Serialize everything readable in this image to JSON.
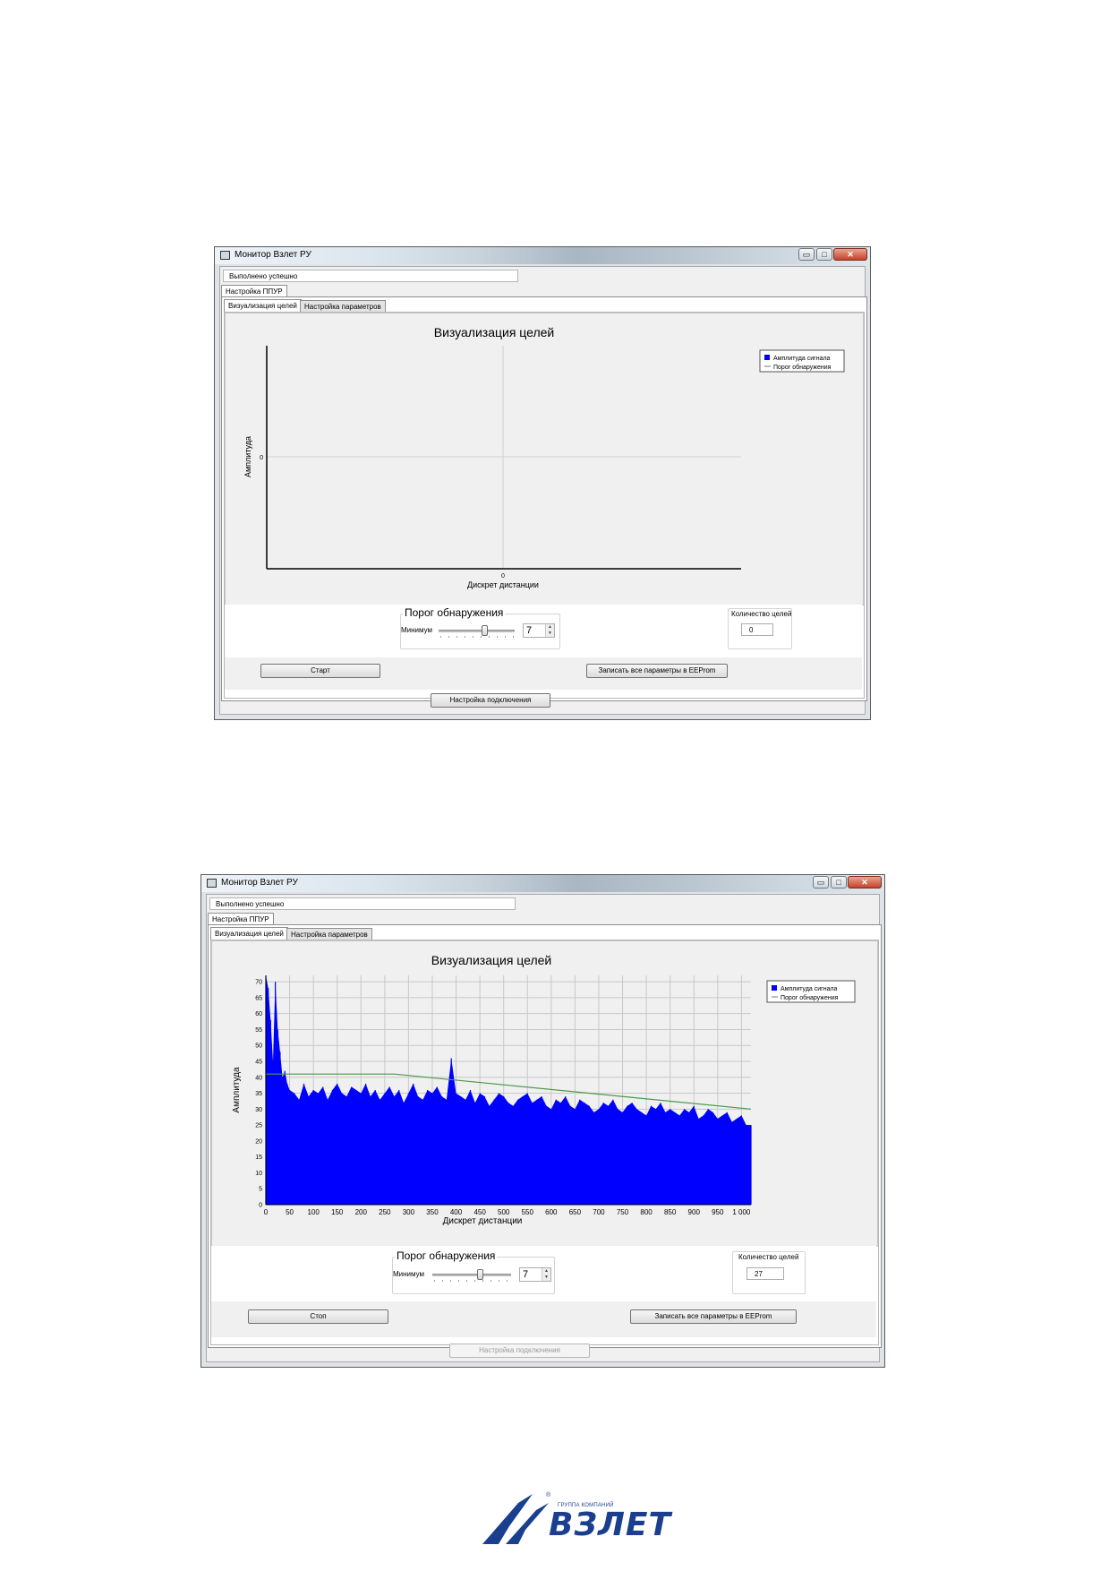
{
  "screenshots": [
    {
      "window_title": "Монитор Взлет РУ",
      "status": "Выполнено успешно",
      "outer_tab": "Настройка ППУР",
      "tabs": [
        "Визуализация целей",
        "Настройка параметров"
      ],
      "threshold_group": "Порог обнаружения",
      "min_label": "Минимум",
      "min_value": "7",
      "count_label": "Количество целей",
      "count_value": "0",
      "start_button": "Старт",
      "save_button": "Записать все параметры в EEProm",
      "connect_button": "Настройка подключения"
    },
    {
      "window_title": "Монитор Взлет РУ",
      "status": "Выполнено успешно",
      "outer_tab": "Настройка ППУР",
      "tabs": [
        "Визуализация целей",
        "Настройка параметров"
      ],
      "threshold_group": "Порог обнаружения",
      "min_label": "Минимум",
      "min_value": "7",
      "count_label": "Количество целей",
      "count_value": "27",
      "stop_button": "Стоп",
      "save_button": "Записать все параметры в EEProm",
      "connect_button": "Настройка подключения"
    }
  ],
  "window_controls": {
    "minimize": "▭",
    "maximize": "□",
    "close": "✕"
  },
  "chart_data": [
    {
      "type": "line",
      "title": "Визуализация целей",
      "xlabel": "Дискрет дистанции",
      "ylabel": "Амплитуда",
      "x_ticks": [
        "0"
      ],
      "y_ticks": [
        "0"
      ],
      "legend": [
        "Амплитуда сигнала",
        "Порог обнаружения"
      ],
      "legend_position": "top-right",
      "series": [
        {
          "name": "Амплитуда сигнала",
          "values": [],
          "color": "#0000ff"
        },
        {
          "name": "Порог обнаружения",
          "values": [],
          "color": "#4a9a4a"
        }
      ],
      "grid": true
    },
    {
      "type": "bar",
      "title": "Визуализация целей",
      "xlabel": "Дискрет дистанции",
      "ylabel": "Амплитуда",
      "xlim": [
        0,
        1020
      ],
      "ylim": [
        0,
        72
      ],
      "x_ticks": [
        "0",
        "50",
        "100",
        "150",
        "200",
        "250",
        "300",
        "350",
        "400",
        "450",
        "500",
        "550",
        "600",
        "650",
        "700",
        "750",
        "800",
        "850",
        "900",
        "950",
        "1 000"
      ],
      "y_ticks": [
        "0",
        "5",
        "10",
        "15",
        "20",
        "25",
        "30",
        "35",
        "40",
        "45",
        "50",
        "55",
        "60",
        "65",
        "70"
      ],
      "legend": [
        "Амплитуда сигнала",
        "Порог обнаружения"
      ],
      "legend_position": "top-right",
      "grid": true,
      "series": [
        {
          "name": "Амплитуда сигнала",
          "type": "bar",
          "color": "#0000ff",
          "x": [
            0,
            5,
            10,
            15,
            20,
            25,
            30,
            35,
            40,
            45,
            50,
            60,
            70,
            80,
            90,
            100,
            110,
            120,
            130,
            140,
            150,
            160,
            170,
            180,
            190,
            200,
            210,
            220,
            230,
            240,
            250,
            260,
            270,
            280,
            290,
            300,
            310,
            320,
            330,
            340,
            350,
            360,
            370,
            380,
            390,
            400,
            410,
            420,
            430,
            440,
            450,
            460,
            470,
            480,
            490,
            500,
            510,
            520,
            530,
            540,
            550,
            560,
            570,
            580,
            590,
            600,
            610,
            620,
            630,
            640,
            650,
            660,
            670,
            680,
            690,
            700,
            710,
            720,
            730,
            740,
            750,
            760,
            770,
            780,
            790,
            800,
            810,
            820,
            830,
            840,
            850,
            860,
            870,
            880,
            890,
            900,
            910,
            920,
            930,
            940,
            950,
            960,
            970,
            980,
            990,
            1000,
            1010,
            1020
          ],
          "values": [
            72,
            68,
            58,
            45,
            70,
            55,
            48,
            40,
            42,
            38,
            36,
            35,
            33,
            38,
            34,
            36,
            35,
            37,
            33,
            36,
            38,
            35,
            34,
            37,
            36,
            35,
            38,
            34,
            36,
            33,
            35,
            37,
            34,
            36,
            32,
            35,
            38,
            34,
            33,
            36,
            35,
            37,
            34,
            33,
            46,
            35,
            34,
            33,
            36,
            32,
            35,
            34,
            31,
            33,
            35,
            34,
            32,
            31,
            33,
            34,
            35,
            32,
            33,
            34,
            31,
            30,
            33,
            32,
            34,
            31,
            30,
            33,
            32,
            31,
            29,
            30,
            32,
            31,
            33,
            30,
            29,
            31,
            32,
            30,
            29,
            28,
            31,
            30,
            32,
            29,
            30,
            29,
            28,
            30,
            29,
            31,
            27,
            28,
            30,
            29,
            27,
            28,
            29,
            26,
            27,
            28,
            25,
            25
          ]
        },
        {
          "name": "Порог обнаружения",
          "type": "line",
          "color": "#4a9a4a",
          "x": [
            0,
            270,
            1020
          ],
          "values": [
            41,
            41,
            30
          ]
        }
      ]
    }
  ],
  "logo": {
    "tagline": "ГРУППА КОМПАНИЙ",
    "brand": "ВЗЛЕТ",
    "registered": "®"
  }
}
